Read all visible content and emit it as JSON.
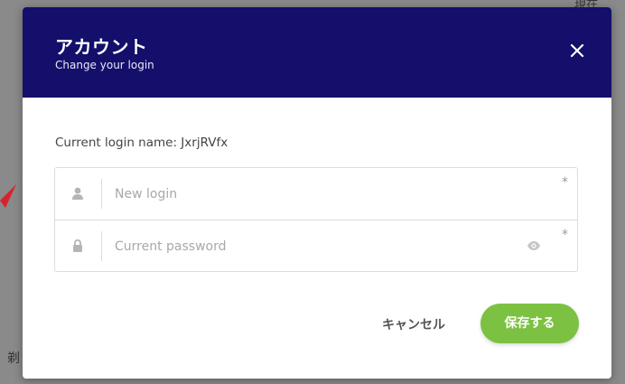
{
  "colors": {
    "header_bg": "#140f6b",
    "primary_button": "#7cc142",
    "overlay": "#8a8a8a"
  },
  "background": {
    "edge_text": "現在",
    "left_char": "剃"
  },
  "modal": {
    "title": "アカウント",
    "subtitle": "Change your login",
    "close_icon": "close-icon",
    "current_login_label": "Current login name: JxrjRVfx",
    "fields": {
      "new_login": {
        "placeholder": "New login",
        "value": "",
        "required_mark": "*",
        "icon": "user-icon"
      },
      "current_password": {
        "placeholder": "Current password",
        "value": "",
        "required_mark": "*",
        "icon": "lock-icon",
        "toggle_icon": "eye-icon"
      }
    },
    "buttons": {
      "cancel_label": "キャンセル",
      "save_label": "保存する"
    }
  }
}
